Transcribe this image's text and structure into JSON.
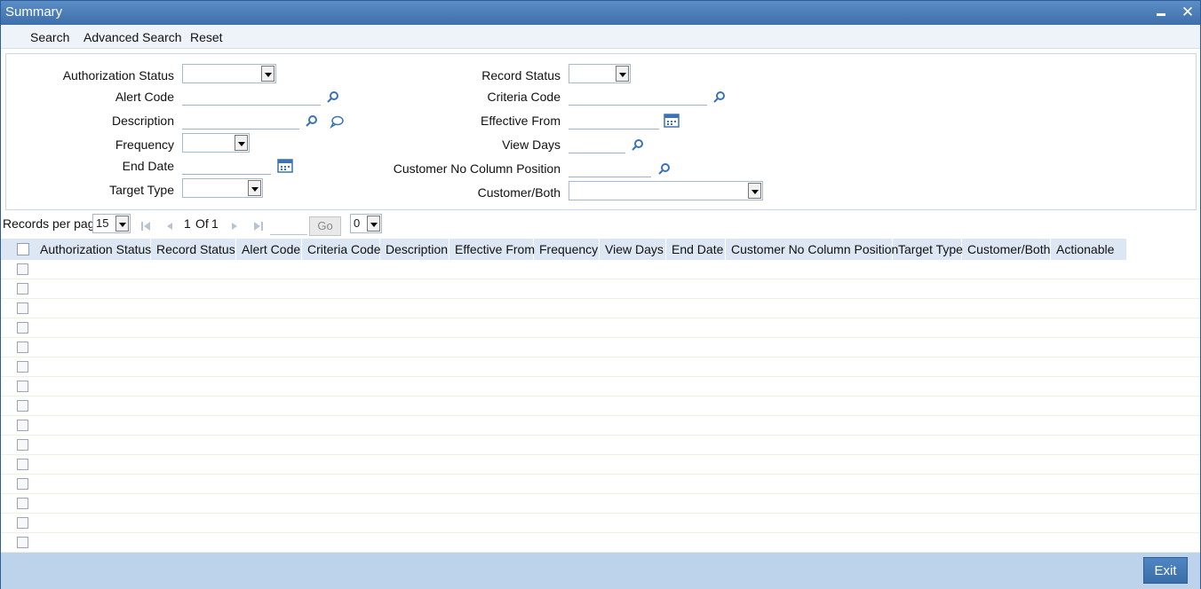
{
  "window": {
    "title": "Summary"
  },
  "toolbar": {
    "search": "Search",
    "advanced_search": "Advanced Search",
    "reset": "Reset"
  },
  "criteria": {
    "authorization_status": "Authorization Status",
    "alert_code": "Alert Code",
    "description": "Description",
    "frequency": "Frequency",
    "end_date": "End Date",
    "target_type": "Target Type",
    "record_status": "Record Status",
    "criteria_code": "Criteria Code",
    "effective_from": "Effective From",
    "view_days": "View Days",
    "customer_no_column_position": "Customer No Column Position",
    "customer_both": "Customer/Both"
  },
  "pager": {
    "records_per_page_label": "Records per page",
    "records_per_page_value": "15",
    "current": "1",
    "of_label": "Of",
    "total": "1",
    "go": "Go",
    "extra_select": "0"
  },
  "grid": {
    "columns": [
      "Authorization Status",
      "Record Status",
      "Alert Code",
      "Criteria Code",
      "Description",
      "Effective From",
      "Frequency",
      "View Days",
      "End Date",
      "Customer No Column Position",
      "Target Type",
      "Customer/Both",
      "Actionable"
    ],
    "row_count": 15
  },
  "footer": {
    "exit": "Exit"
  },
  "colors": {
    "title_bar": "#4a7cb8",
    "footer": "#bcd3eb",
    "header": "#dde7f3",
    "icon": "#3b73b5"
  },
  "icons": [
    "search-icon",
    "comment-icon",
    "calendar-icon",
    "first-page-icon",
    "prev-page-icon",
    "next-page-icon",
    "last-page-icon",
    "minimize-icon",
    "close-icon"
  ]
}
